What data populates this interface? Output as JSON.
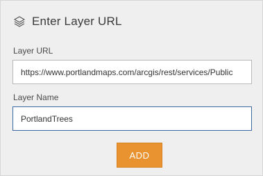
{
  "header": {
    "icon": "layers-icon",
    "title": "Enter Layer URL"
  },
  "fields": {
    "url": {
      "label": "Layer URL",
      "value": "https://www.portlandmaps.com/arcgis/rest/services/Public"
    },
    "name": {
      "label": "Layer Name",
      "value": "PortlandTrees"
    }
  },
  "actions": {
    "add_label": "ADD"
  },
  "colors": {
    "panel_bg": "#efefef",
    "accent_button": "#e8932f",
    "focus_border": "#3b68a5"
  }
}
